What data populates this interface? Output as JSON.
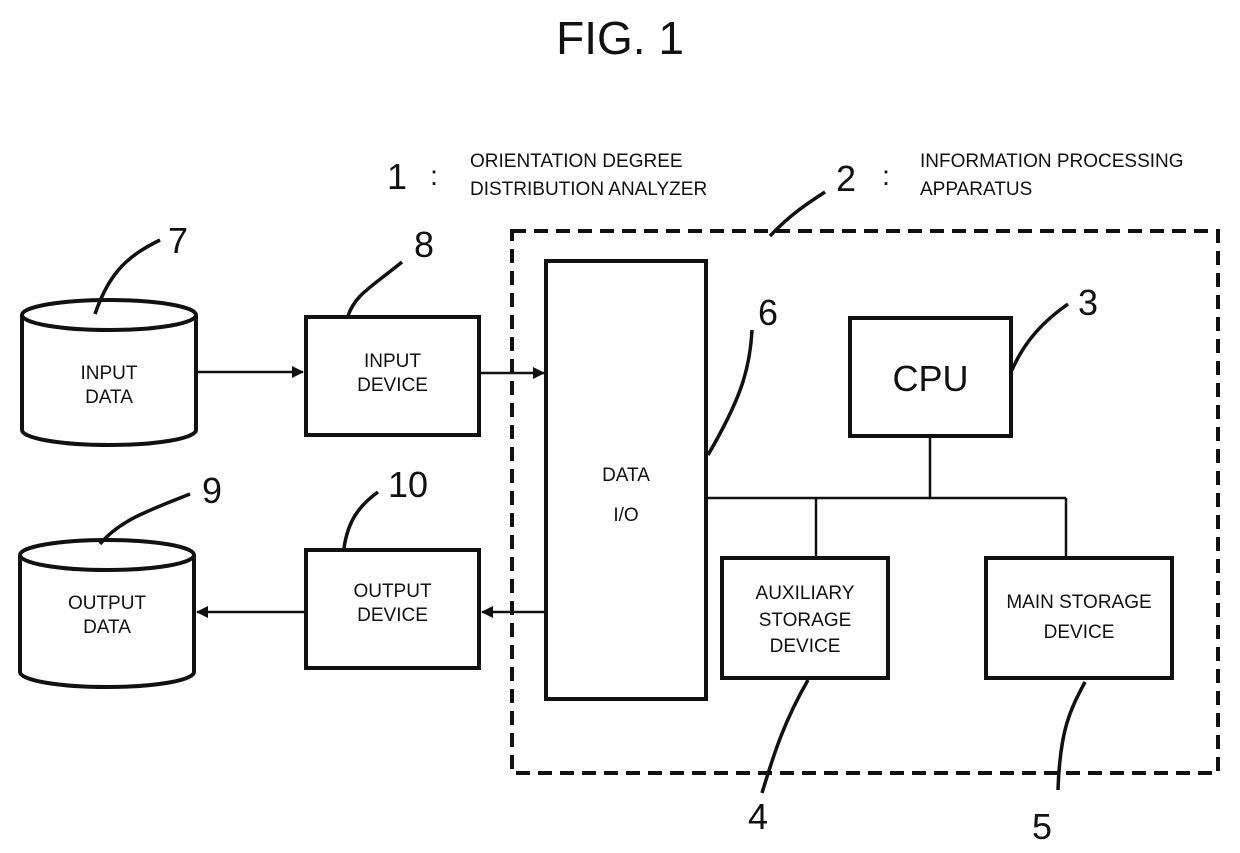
{
  "figure": {
    "title": "FIG. 1"
  },
  "legend": [
    {
      "ref": "1",
      "separator": ":",
      "line1": "ORIENTATION DEGREE",
      "line2": "DISTRIBUTION ANALYZER"
    },
    {
      "ref": "2",
      "separator": ":",
      "line1": "INFORMATION PROCESSING",
      "line2": "APPARATUS"
    }
  ],
  "nodes": {
    "input_data": {
      "ref": "7",
      "line1": "INPUT",
      "line2": "DATA",
      "shape": "cylinder"
    },
    "input_device": {
      "ref": "8",
      "line1": "INPUT",
      "line2": "DEVICE",
      "shape": "box"
    },
    "output_data": {
      "ref": "9",
      "line1": "OUTPUT",
      "line2": "DATA",
      "shape": "cylinder"
    },
    "output_device": {
      "ref": "10",
      "line1": "OUTPUT",
      "line2": "DEVICE",
      "shape": "box"
    },
    "data_io": {
      "ref": "6",
      "line1": "DATA",
      "line2": "I/O",
      "shape": "box"
    },
    "cpu": {
      "ref": "3",
      "label": "CPU",
      "shape": "box"
    },
    "aux_storage": {
      "ref": "4",
      "line1": "AUXILIARY",
      "line2": "STORAGE",
      "line3": "DEVICE",
      "shape": "box"
    },
    "main_storage": {
      "ref": "5",
      "line1": "MAIN STORAGE",
      "line2": "DEVICE",
      "shape": "box"
    }
  },
  "edges": [
    {
      "from": "input_data",
      "to": "input_device",
      "arrow": "forward"
    },
    {
      "from": "input_device",
      "to": "data_io",
      "arrow": "forward"
    },
    {
      "from": "data_io",
      "to": "output_device",
      "arrow": "forward"
    },
    {
      "from": "output_device",
      "to": "output_data",
      "arrow": "forward"
    },
    {
      "from": "data_io",
      "to": "bus",
      "arrow": "none"
    },
    {
      "from": "cpu",
      "to": "bus",
      "arrow": "none"
    },
    {
      "from": "bus",
      "to": "aux_storage",
      "arrow": "none"
    },
    {
      "from": "bus",
      "to": "main_storage",
      "arrow": "none"
    }
  ],
  "groups": [
    {
      "ref": "2",
      "name": "information_processing_apparatus",
      "style": "dashed",
      "contains": [
        "data_io",
        "cpu",
        "aux_storage",
        "main_storage"
      ]
    }
  ]
}
